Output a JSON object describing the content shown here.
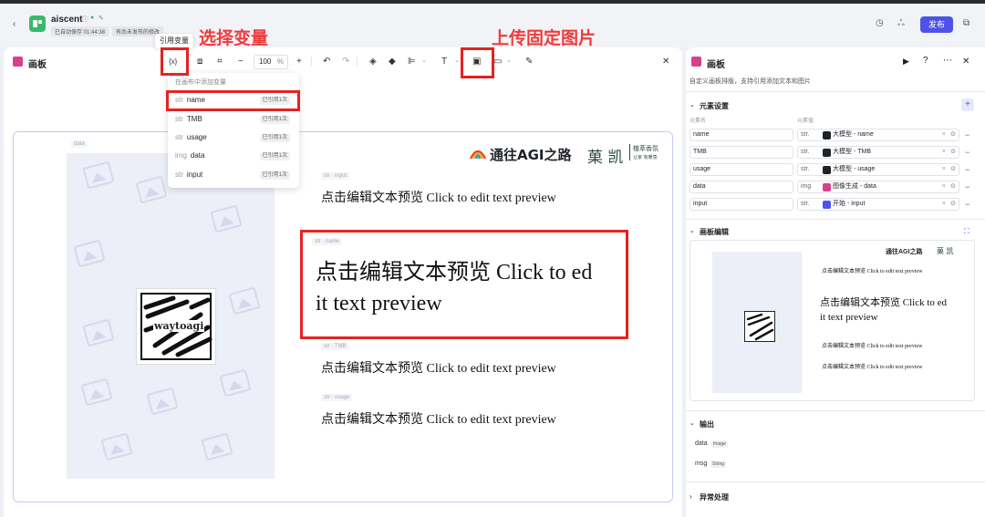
{
  "topbar": {
    "app_name": "aiscent",
    "autosave": "已自动保存 01:44:38",
    "unpublished": "有尚未发布的修改",
    "publish_label": "发布"
  },
  "annotations": {
    "select_variable": "选择变量",
    "upload_image": "上传固定图片",
    "tooltip": "引用变量"
  },
  "canvas": {
    "panel_title": "画板",
    "zoom_value": "100",
    "zoom_unit": "%",
    "var_button": "{x}",
    "brand_text": "通往AGI之路",
    "brand_name": "菓 凯",
    "brand_tag": "植萃香氛",
    "brand_slogan": "让家·有暖意·",
    "qr_text": "waytoagi",
    "image_tag": "data",
    "elements": [
      {
        "tag": "str · input",
        "text": "点击编辑文本预览 Click to edit text preview"
      },
      {
        "tag": "str · name",
        "line1": "点击编辑文本预览 Click to ed",
        "line2": "it text preview"
      },
      {
        "tag": "str · TMB",
        "text": "点击编辑文本预览 Click to edit text preview"
      },
      {
        "tag": "str · usage",
        "text": "点击编辑文本预览 Click to edit text preview"
      }
    ]
  },
  "dropdown": {
    "header": "在画布中添加变量",
    "items": [
      {
        "type": "str",
        "name": "name",
        "used": "已引用1次"
      },
      {
        "type": "str",
        "name": "TMB",
        "used": "已引用1次"
      },
      {
        "type": "str",
        "name": "usage",
        "used": "已引用1次"
      },
      {
        "type": "img",
        "name": "data",
        "used": "已引用1次"
      },
      {
        "type": "str",
        "name": "input",
        "used": "已引用1次"
      }
    ]
  },
  "right_panel": {
    "title": "画板",
    "subtitle": "自定义画板排版，支持引用添加文本和图片",
    "element_settings": "元素设置",
    "col_name": "元素名",
    "col_value": "元素值",
    "rows": [
      {
        "name": "name",
        "type": "str.",
        "value": "大模型 - name",
        "color": "#1f2329"
      },
      {
        "name": "TMB",
        "type": "str.",
        "value": "大模型 - TMB",
        "color": "#1f2329"
      },
      {
        "name": "usage",
        "type": "str.",
        "value": "大模型 - usage",
        "color": "#1f2329"
      },
      {
        "name": "data",
        "type": "img",
        "value": "图像生成 - data",
        "color": "#d6418b"
      },
      {
        "name": "input",
        "type": "str.",
        "value": "开始 - input",
        "color": "#4d53e8"
      }
    ],
    "canvas_edit": "画板编辑",
    "preview_brand": "通往AGI之路",
    "preview_brand2": "菓 凯",
    "preview_small": "点击编辑文本预览 Click to edit text preview",
    "preview_large1": "点击编辑文本预览 Click to ed",
    "preview_large2": "it text preview",
    "output": "输出",
    "outputs": [
      {
        "name": "data",
        "type": "Image"
      },
      {
        "name": "msg",
        "type": "String"
      }
    ],
    "exception": "异常处理"
  }
}
